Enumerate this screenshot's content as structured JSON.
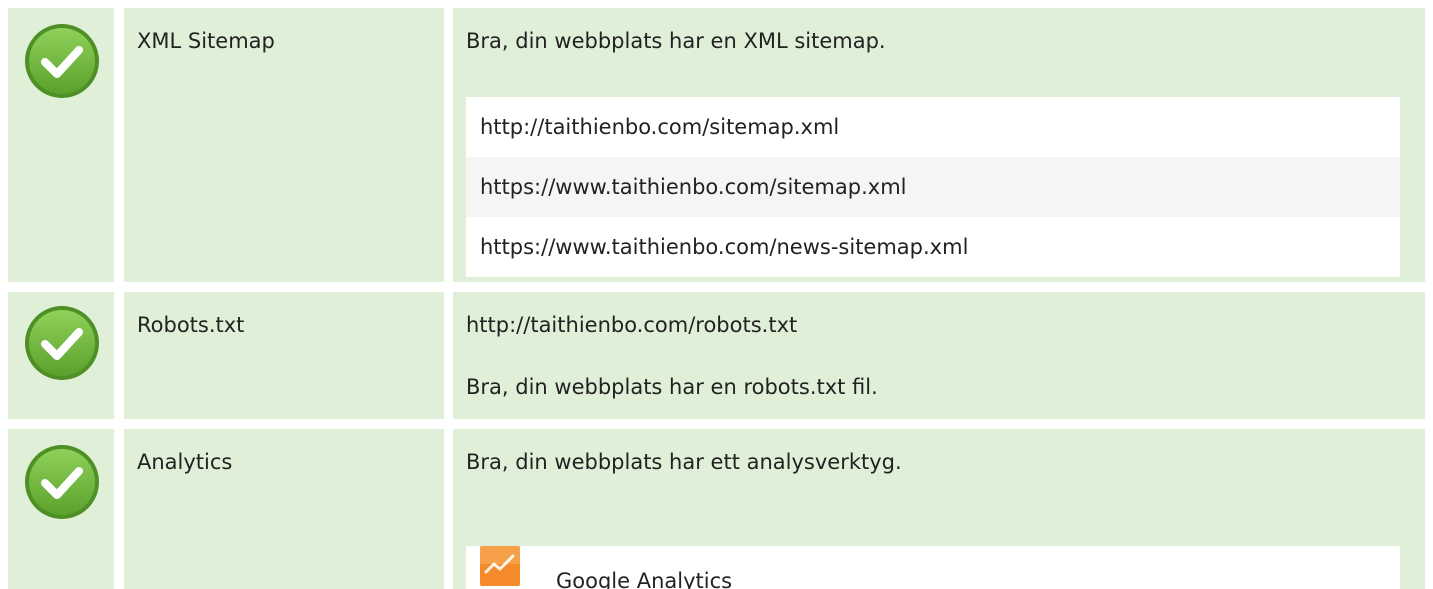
{
  "colors": {
    "row_bg": "#e0f0d8",
    "check_green": "#6cb33f",
    "ga_orange": "#f58a2a"
  },
  "rows": [
    {
      "status_icon": "check-icon",
      "label": "XML Sitemap",
      "message": "Bra, din webbplats har en XML sitemap.",
      "urls": [
        "http://taithienbo.com/sitemap.xml",
        "https://www.taithienbo.com/sitemap.xml",
        "https://www.taithienbo.com/news-sitemap.xml"
      ]
    },
    {
      "status_icon": "check-icon",
      "label": "Robots.txt",
      "url": "http://taithienbo.com/robots.txt",
      "message": "Bra, din webbplats har en robots.txt fil."
    },
    {
      "status_icon": "check-icon",
      "label": "Analytics",
      "message": "Bra, din webbplats har ett analysverktyg.",
      "tools": [
        {
          "icon": "google-analytics-icon",
          "name": "Google Analytics"
        }
      ]
    }
  ]
}
